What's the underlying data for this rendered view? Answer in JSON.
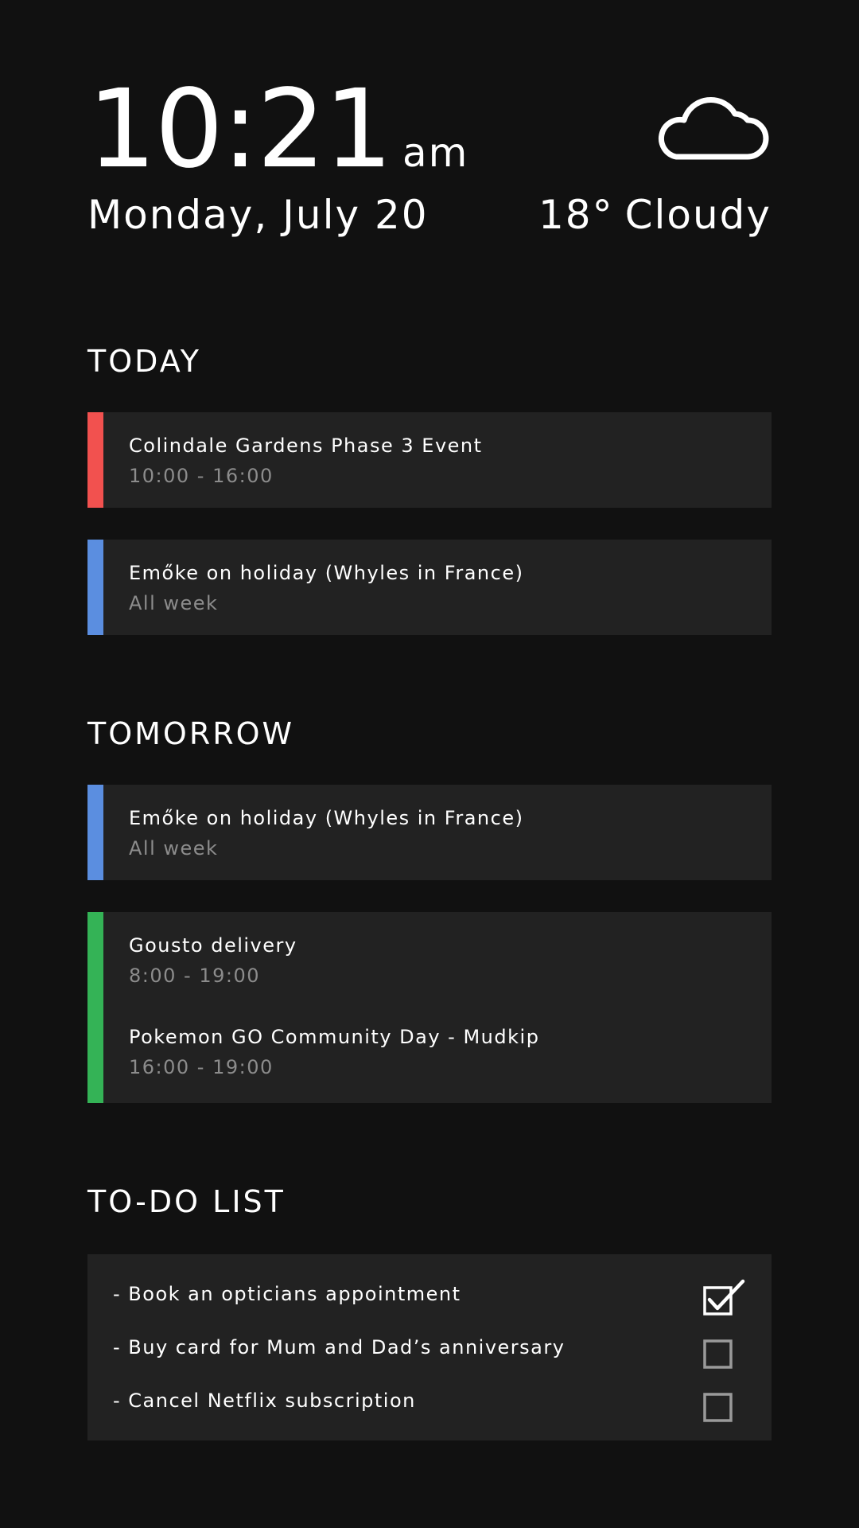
{
  "header": {
    "time": "10:21",
    "ampm": "am",
    "date": "Monday, July 20",
    "temperature": "18°",
    "condition": "Cloudy",
    "weather_icon": "cloud-icon"
  },
  "sections": {
    "today": {
      "heading": "TODAY",
      "events": [
        {
          "title": "Colindale Gardens Phase 3 Event",
          "time": "10:00 - 16:00",
          "color": "#f2514f"
        },
        {
          "title": "Emőke on holiday (Whyles in France)",
          "time": "All week",
          "color": "#5b8ee0"
        }
      ]
    },
    "tomorrow": {
      "heading": "TOMORROW",
      "events": [
        {
          "title": "Emőke on holiday (Whyles in France)",
          "time": "All week",
          "color": "#5b8ee0"
        },
        {
          "title": "Gousto delivery",
          "time": "8:00 - 19:00",
          "color": "#34b356"
        },
        {
          "title": "Pokemon GO Community Day - Mudkip",
          "time": "16:00 - 19:00",
          "color": "#34b356"
        }
      ]
    }
  },
  "todo": {
    "heading": "TO-DO LIST",
    "items": [
      {
        "text": "- Book an opticians appointment",
        "checked": true
      },
      {
        "text": "- Buy card for Mum and Dad’s anniversary",
        "checked": false
      },
      {
        "text": "- Cancel Netflix subscription",
        "checked": false
      }
    ]
  }
}
